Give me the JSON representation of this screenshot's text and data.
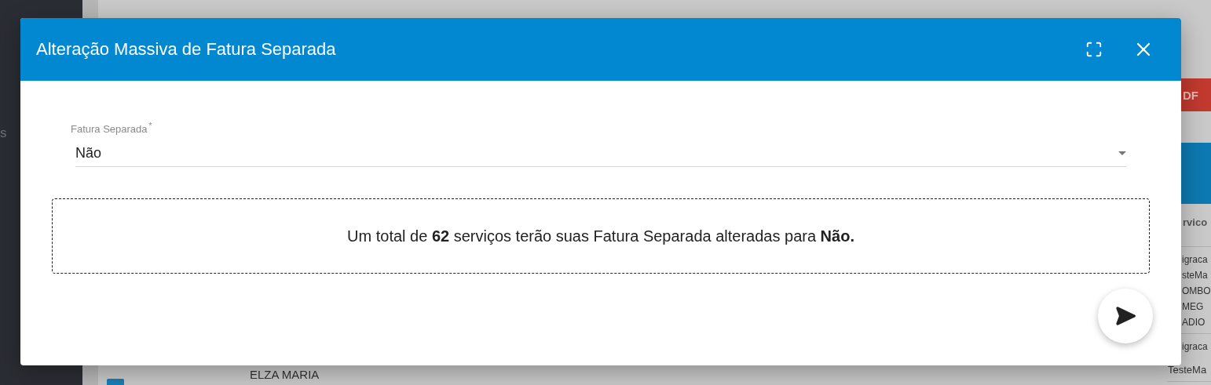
{
  "background": {
    "sidebar_label": "s",
    "pdf_button": "DF",
    "table_header": "rvico",
    "rows": [
      {
        "lines": [
          "igraca",
          "steMa",
          "OMBO",
          "MEG",
          "ADIO"
        ]
      },
      {
        "lines": [
          "igraca",
          "TesteMa"
        ]
      }
    ],
    "name_cell": "ELZA MARIA",
    "checkbox": {
      "checked": true
    }
  },
  "dialog": {
    "title": "Alteração Massiva de Fatura Separada",
    "field": {
      "label": "Fatura Separada",
      "required_mark": "*",
      "value": "Não"
    },
    "message": "Um total de **62** serviços terão suas Fatura Separada alteradas para **Não.**"
  }
}
